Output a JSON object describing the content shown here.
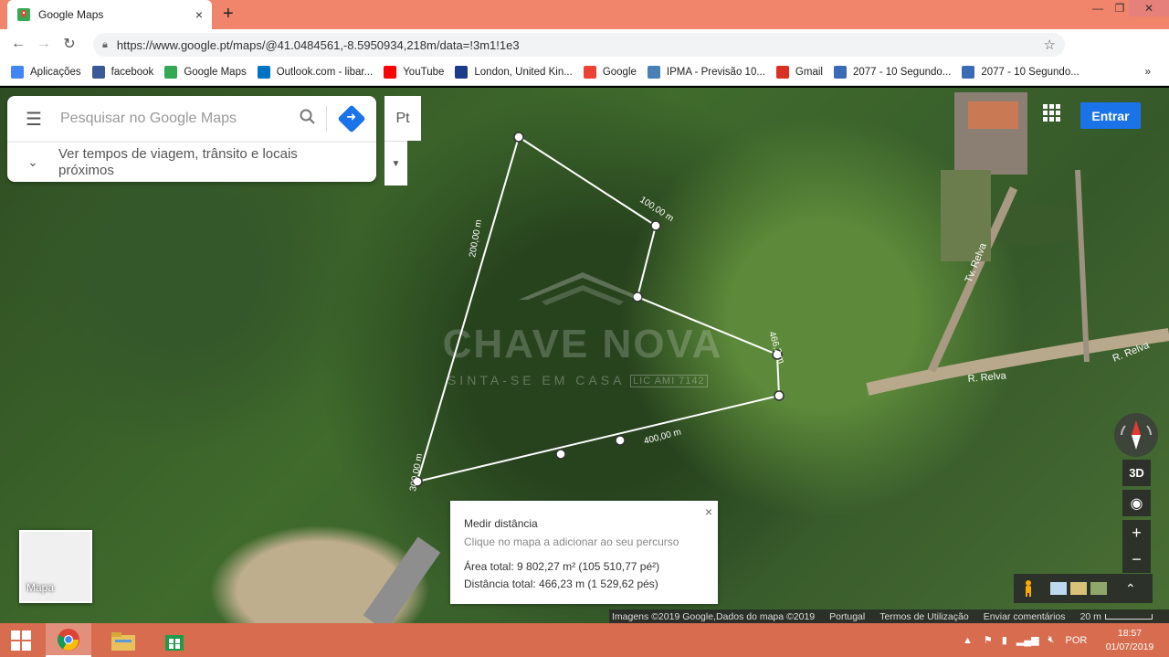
{
  "browser": {
    "tab_title": "Google Maps",
    "tab_close": "×",
    "new_tab": "+",
    "url": "https://www.google.pt/maps/@41.0484561,-8.5950934,218m/data=!3m1!1e3",
    "window_controls": [
      "—",
      "❐",
      "✕"
    ]
  },
  "bookmarks": [
    {
      "label": "Aplicações",
      "icon": "apps-grid-icon",
      "color": "#4285f4"
    },
    {
      "label": "facebook",
      "icon": "facebook-icon",
      "color": "#3b5998"
    },
    {
      "label": "Google Maps",
      "icon": "google-maps-icon",
      "color": "#34a853"
    },
    {
      "label": "Outlook.com - libar...",
      "icon": "outlook-icon",
      "color": "#0072c6"
    },
    {
      "label": "YouTube",
      "icon": "youtube-icon",
      "color": "#ff0000"
    },
    {
      "label": "London, United Kin...",
      "icon": "weather-flag-icon",
      "color": "#1a3a8a"
    },
    {
      "label": "Google",
      "icon": "google-icon",
      "color": "#ea4335"
    },
    {
      "label": "IPMA - Previsão 10...",
      "icon": "ipma-icon",
      "color": "#4a7fb5"
    },
    {
      "label": "Gmail",
      "icon": "gmail-icon",
      "color": "#d93025"
    },
    {
      "label": "2077 - 10 Segundo...",
      "icon": "link-icon",
      "color": "#3b6bb5"
    },
    {
      "label": "2077 - 10 Segundo...",
      "icon": "link-icon",
      "color": "#3b6bb5"
    }
  ],
  "bookmarks_more": "»",
  "maps": {
    "search_placeholder": "Pesquisar no Google Maps",
    "travel_times": "Ver tempos de viagem, trânsito e locais próximos",
    "language": "Pt",
    "sign_in": "Entrar",
    "three_d": "3D",
    "zoom_in": "+",
    "zoom_out": "−",
    "minimap_label": "Mapa"
  },
  "map_labels": {
    "road_1": "Tv. Relva",
    "road_2": "R. Relva",
    "road_3": "R. Relva",
    "seg_100": "100,00 m",
    "seg_200": "200,00 m",
    "seg_300": "300,00 m",
    "seg_400": "400,00 m",
    "total_end": "466,2 m"
  },
  "watermark": {
    "brand": "CHAVE NOVA",
    "tagline": "SINTA-SE EM CASA",
    "license": "LIC AMI 7142"
  },
  "measure": {
    "title": "Medir distância",
    "hint": "Clique no mapa a adicionar ao seu percurso",
    "area": "Área total: 9 802,27 m² (105 510,77 pé²)",
    "distance": "Distância total: 466,23 m (1 529,62 pés)",
    "close": "×"
  },
  "attribution": {
    "imagery": "Imagens ©2019 Google,Dados do mapa ©2019",
    "country": "Portugal",
    "terms": "Termos de Utilização",
    "feedback": "Enviar comentários",
    "scale": "20 m"
  },
  "taskbar": {
    "language": "POR",
    "time": "18:57",
    "date": "01/07/2019"
  }
}
